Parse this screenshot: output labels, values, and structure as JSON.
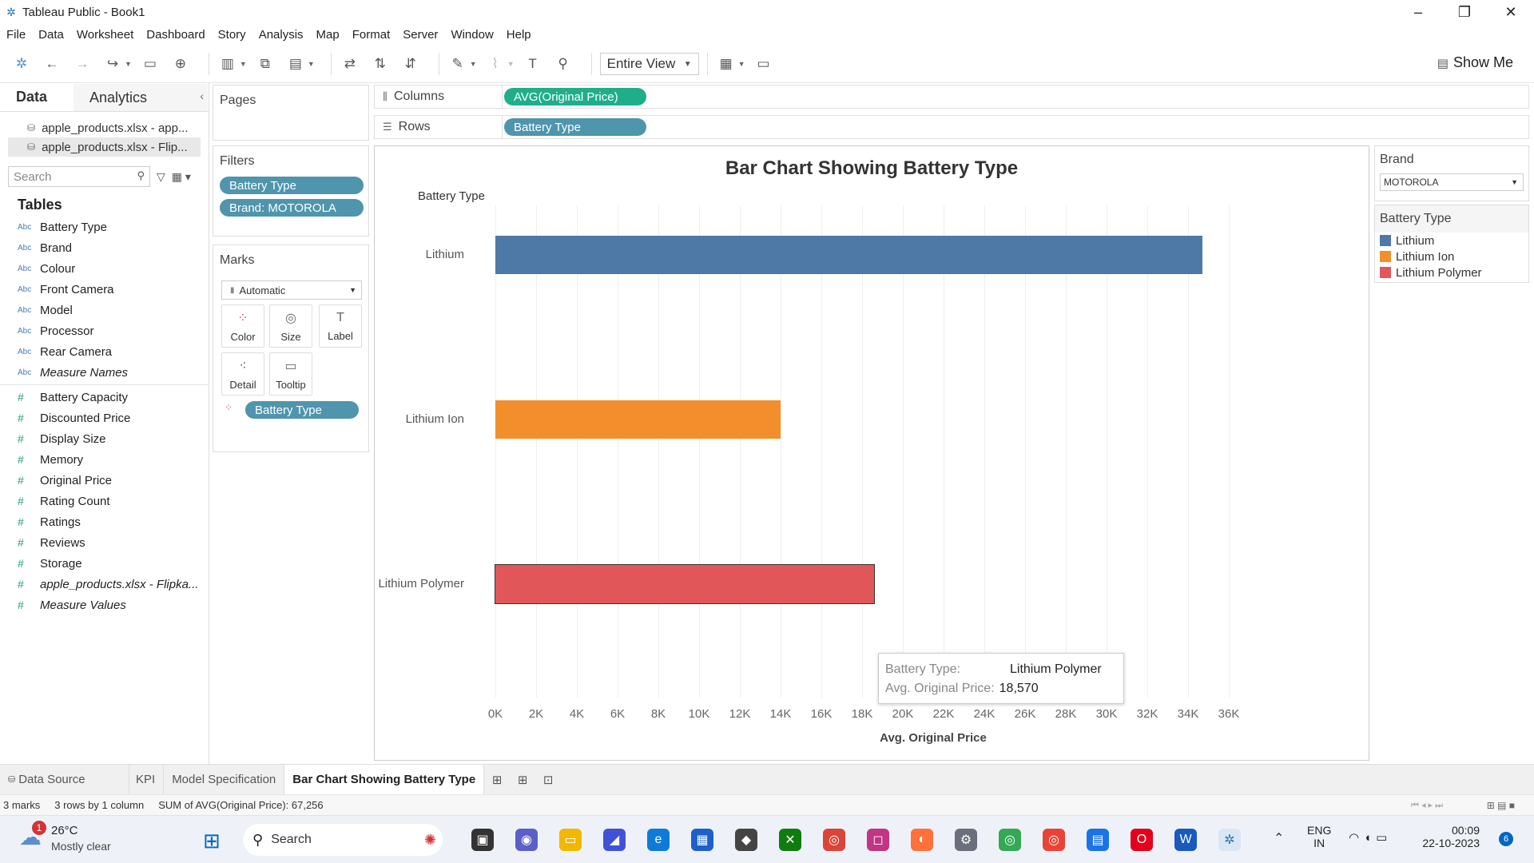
{
  "window": {
    "title": "Tableau Public - Book1"
  },
  "menu": [
    "File",
    "Data",
    "Worksheet",
    "Dashboard",
    "Story",
    "Analysis",
    "Map",
    "Format",
    "Server",
    "Window",
    "Help"
  ],
  "toolbar": {
    "view_option": "Entire View",
    "show_me": "Show Me"
  },
  "data_pane": {
    "tabs": {
      "data": "Data",
      "analytics": "Analytics"
    },
    "sources": [
      "apple_products.xlsx - app...",
      "apple_products.xlsx - Flip..."
    ],
    "search_placeholder": "Search",
    "tables_header": "Tables",
    "dimensions": [
      "Battery Type",
      "Brand",
      "Colour",
      "Front Camera",
      "Model",
      "Processor",
      "Rear Camera",
      "Measure Names"
    ],
    "measures": [
      "Battery Capacity",
      "Discounted Price",
      "Display Size",
      "Memory",
      "Original Price",
      "Rating Count",
      "Ratings",
      "Reviews",
      "Storage",
      "apple_products.xlsx - Flipka...",
      "Measure Values"
    ]
  },
  "pages": {
    "header": "Pages"
  },
  "filters": {
    "header": "Filters",
    "pills": [
      "Battery Type",
      "Brand: MOTOROLA"
    ]
  },
  "marks": {
    "header": "Marks",
    "type": "Automatic",
    "buttons": [
      "Color",
      "Size",
      "Label",
      "Detail",
      "Tooltip"
    ],
    "color_pill": "Battery Type"
  },
  "shelves": {
    "columns_label": "Columns",
    "columns_pill": "AVG(Original Price)",
    "rows_label": "Rows",
    "rows_pill": "Battery Type"
  },
  "chart_data": {
    "type": "bar",
    "orientation": "horizontal",
    "title": "Bar Chart Showing Battery Type",
    "ylabel": "Battery Type",
    "xlabel": "Avg. Original Price",
    "categories": [
      "Lithium",
      "Lithium Ion",
      "Lithium Polymer"
    ],
    "values": [
      34700,
      14000,
      18570
    ],
    "colors": [
      "#4e79a7",
      "#f28e2b",
      "#e15759"
    ],
    "xlim": [
      0,
      36000
    ],
    "ticks": [
      "0K",
      "2K",
      "4K",
      "6K",
      "8K",
      "10K",
      "12K",
      "14K",
      "16K",
      "18K",
      "20K",
      "22K",
      "24K",
      "26K",
      "28K",
      "30K",
      "32K",
      "34K",
      "36K"
    ],
    "grid": true
  },
  "tooltip": {
    "k1": "Battery Type:",
    "v1": "Lithium Polymer",
    "k2": "Avg. Original Price:",
    "v2": "18,570"
  },
  "brand_filter": {
    "header": "Brand",
    "value": "MOTOROLA"
  },
  "legend": {
    "header": "Battery Type",
    "items": [
      {
        "label": "Lithium",
        "color": "#4e79a7"
      },
      {
        "label": "Lithium Ion",
        "color": "#f28e2b"
      },
      {
        "label": "Lithium Polymer",
        "color": "#e15759"
      }
    ]
  },
  "sheet_tabs": [
    "Data Source",
    "KPI",
    "Model Specification",
    "Bar Chart Showing Battery Type"
  ],
  "status": {
    "marks": "3 marks",
    "layout": "3 rows by 1 column",
    "sum": "SUM of AVG(Original Price): 67,256"
  },
  "taskbar": {
    "weather_temp": "26°C",
    "weather_desc": "Mostly clear",
    "weather_badge": "1",
    "search": "Search",
    "lang1": "ENG",
    "lang2": "IN",
    "time": "00:09",
    "date": "22-10-2023",
    "notif_count": "6"
  }
}
